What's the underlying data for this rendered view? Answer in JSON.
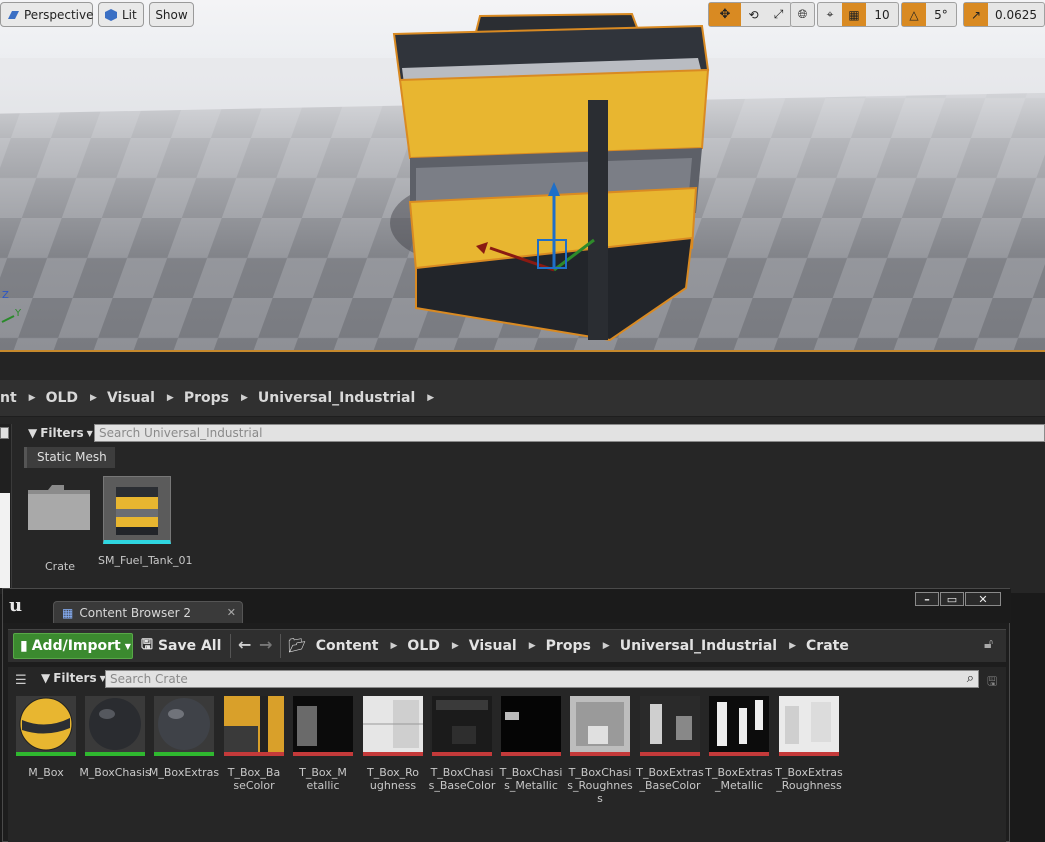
{
  "viewport": {
    "view_mode": "Perspective",
    "lighting": "Lit",
    "show": "Show",
    "grid_snap": "10",
    "rotation_snap": "5°",
    "camera_speed": "0.0625",
    "axis_z": "Z",
    "axis_y": "Y"
  },
  "upper_browser": {
    "breadcrumbs": [
      "nt",
      "OLD",
      "Visual",
      "Props",
      "Universal_Industrial"
    ],
    "filters": "Filters",
    "search_placeholder": "Search Universal_Industrial",
    "filter_tag": "Static Mesh",
    "assets": [
      {
        "label": "Crate"
      },
      {
        "label": "SM_Fuel_Tank_01"
      }
    ]
  },
  "content_browser_2": {
    "tab_title": "Content Browser 2",
    "add_import": "Add/Import",
    "save_all": "Save All",
    "breadcrumbs": [
      "Content",
      "OLD",
      "Visual",
      "Props",
      "Universal_Industrial",
      "Crate"
    ],
    "filters": "Filters",
    "search_placeholder": "Search Crate",
    "assets": [
      {
        "label": "M_Box",
        "kind": "material"
      },
      {
        "label": "M_BoxChasis",
        "kind": "material"
      },
      {
        "label": "M_BoxExtras",
        "kind": "material"
      },
      {
        "label": "T_Box_BaseColor",
        "kind": "texture"
      },
      {
        "label": "T_Box_Metallic",
        "kind": "texture"
      },
      {
        "label": "T_Box_Roughness",
        "kind": "texture"
      },
      {
        "label": "T_BoxChasis_BaseColor",
        "kind": "texture"
      },
      {
        "label": "T_BoxChasis_Metallic",
        "kind": "texture"
      },
      {
        "label": "T_BoxChasis_Roughness",
        "kind": "texture"
      },
      {
        "label": "T_BoxExtras_BaseColor",
        "kind": "texture"
      },
      {
        "label": "T_BoxExtras_Metallic",
        "kind": "texture"
      },
      {
        "label": "T_BoxExtras_Roughness",
        "kind": "texture"
      }
    ]
  },
  "colors": {
    "selection_outline": "#d98a22",
    "add_import_green": "#3b8a2f",
    "material_underline": "#2fb82f",
    "texture_underline": "#c43a3a",
    "crate_yellow": "#e8b630"
  }
}
